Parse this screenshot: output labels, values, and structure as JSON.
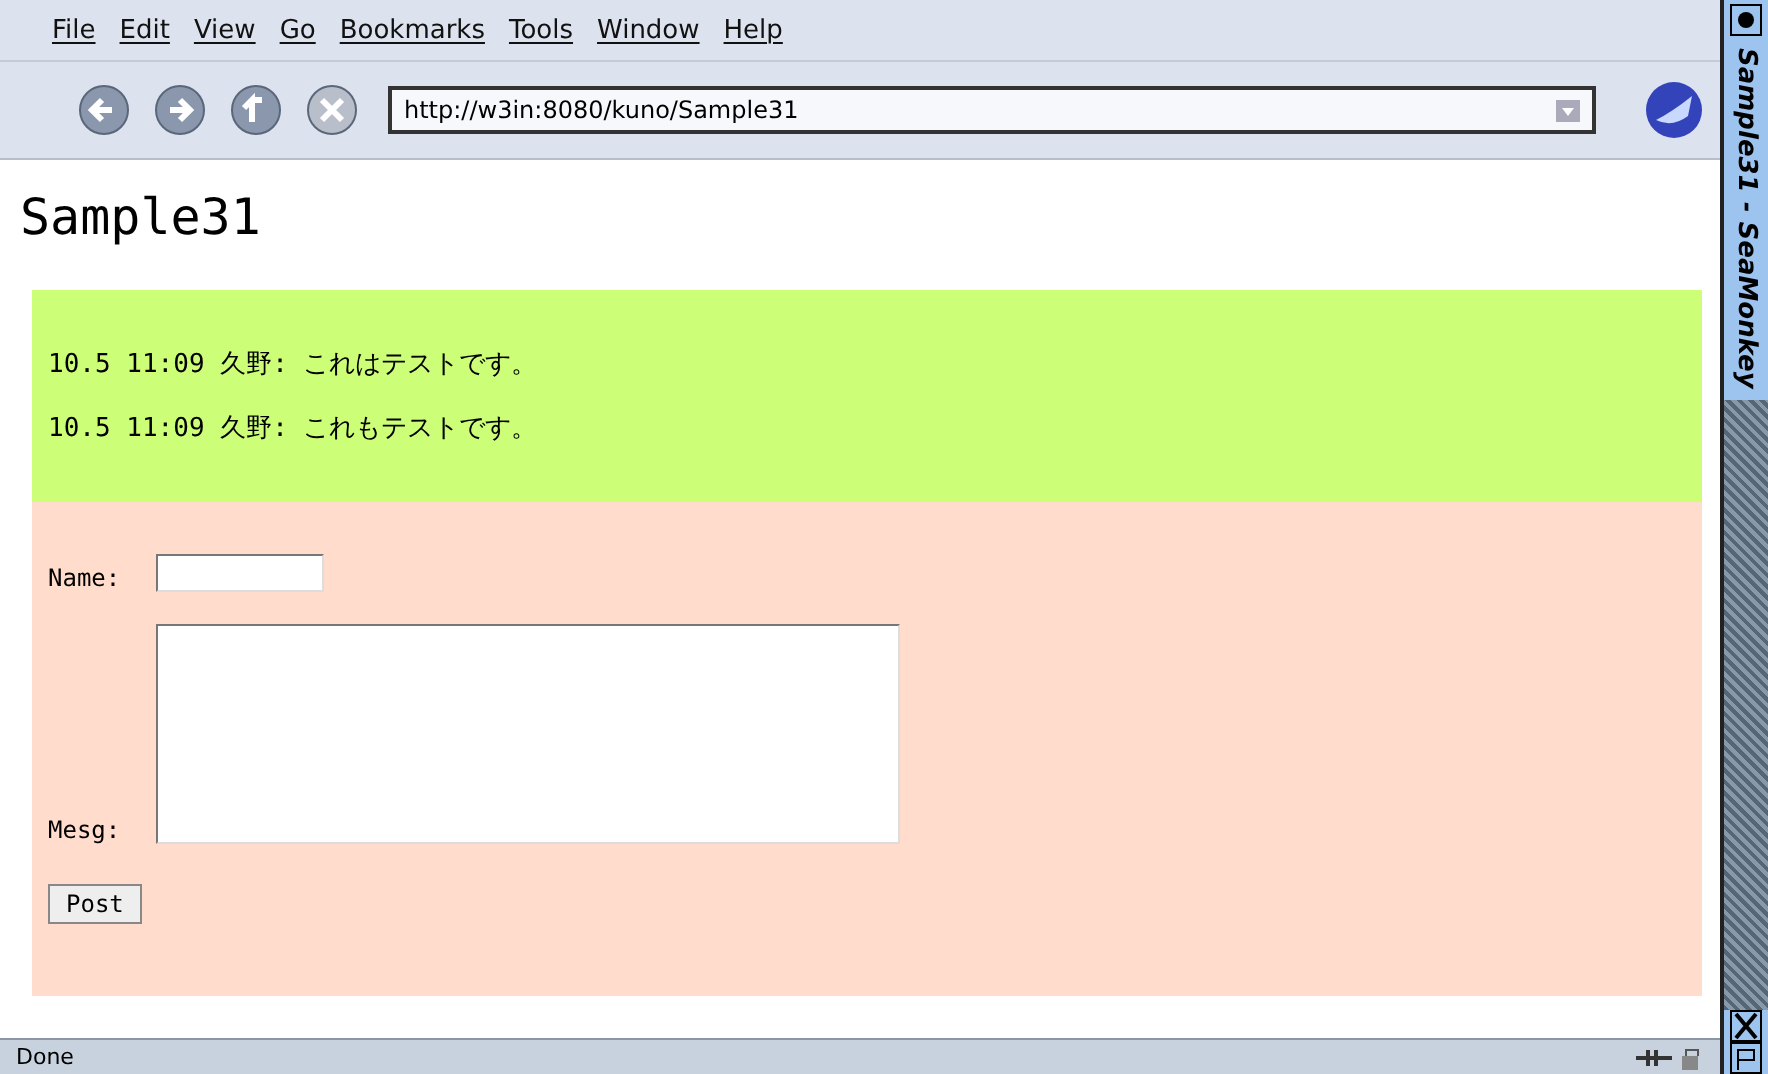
{
  "menu": [
    "File",
    "Edit",
    "View",
    "Go",
    "Bookmarks",
    "Tools",
    "Window",
    "Help"
  ],
  "url": "http://w3in:8080/kuno/Sample31",
  "window_title": "Sample31 - SeaMonkey",
  "heading": "Sample31",
  "messages": [
    "10.5 11:09 久野: これはテストです。",
    "10.5 11:09 久野: これもテストです。"
  ],
  "form": {
    "name_label": "Name:",
    "mesg_label": "Mesg:",
    "button": "Post"
  },
  "status": "Done"
}
